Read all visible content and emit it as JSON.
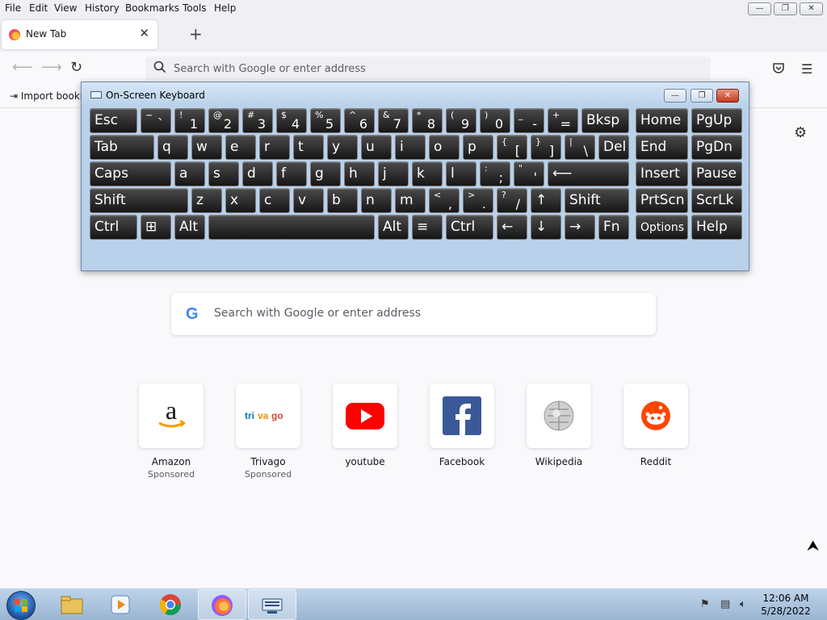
{
  "menubar": {
    "items": [
      "File",
      "Edit",
      "View",
      "History",
      "Bookmarks",
      "Tools",
      "Help"
    ]
  },
  "tabs": {
    "active_title": "New Tab",
    "close_glyph": "✕",
    "new_tab_glyph": "+"
  },
  "navbar": {
    "url_placeholder": "Search with Google or enter address"
  },
  "bookmarks": {
    "import_label": "Import bookmarks"
  },
  "osk": {
    "title": "On-Screen Keyboard",
    "rows": [
      [
        {
          "label": "Esc"
        },
        {
          "shift": "~",
          "main": "`"
        },
        {
          "shift": "!",
          "main": "1"
        },
        {
          "shift": "@",
          "main": "2"
        },
        {
          "shift": "#",
          "main": "3"
        },
        {
          "shift": "$",
          "main": "4"
        },
        {
          "shift": "%",
          "main": "5"
        },
        {
          "shift": "^",
          "main": "6"
        },
        {
          "shift": "&",
          "main": "7"
        },
        {
          "shift": "*",
          "main": "8"
        },
        {
          "shift": "(",
          "main": "9"
        },
        {
          "shift": ")",
          "main": "0"
        },
        {
          "shift": "_",
          "main": "-"
        },
        {
          "shift": "+",
          "main": "="
        },
        {
          "label": "Bksp"
        },
        {
          "label": "Home"
        },
        {
          "label": "PgUp"
        }
      ],
      [
        {
          "label": "Tab"
        },
        {
          "label": "q"
        },
        {
          "label": "w"
        },
        {
          "label": "e"
        },
        {
          "label": "r"
        },
        {
          "label": "t"
        },
        {
          "label": "y"
        },
        {
          "label": "u"
        },
        {
          "label": "i"
        },
        {
          "label": "o"
        },
        {
          "label": "p"
        },
        {
          "shift": "{",
          "main": "["
        },
        {
          "shift": "}",
          "main": "]"
        },
        {
          "shift": "|",
          "main": "\\"
        },
        {
          "label": "Del"
        },
        {
          "label": "End"
        },
        {
          "label": "PgDn"
        }
      ],
      [
        {
          "label": "Caps"
        },
        {
          "label": "a"
        },
        {
          "label": "s"
        },
        {
          "label": "d"
        },
        {
          "label": "f"
        },
        {
          "label": "g"
        },
        {
          "label": "h"
        },
        {
          "label": "j"
        },
        {
          "label": "k"
        },
        {
          "label": "l"
        },
        {
          "shift": ":",
          "main": ";"
        },
        {
          "shift": "\"",
          "main": "'"
        },
        {
          "label": "⟵"
        },
        {
          "label": "Insert"
        },
        {
          "label": "Pause"
        }
      ],
      [
        {
          "label": "Shift"
        },
        {
          "label": "z"
        },
        {
          "label": "x"
        },
        {
          "label": "c"
        },
        {
          "label": "v"
        },
        {
          "label": "b"
        },
        {
          "label": "n"
        },
        {
          "label": "m"
        },
        {
          "shift": "<",
          "main": ","
        },
        {
          "shift": ">",
          "main": "."
        },
        {
          "shift": "?",
          "main": "/"
        },
        {
          "label": "↑"
        },
        {
          "label": "Shift"
        },
        {
          "label": "PrtScn"
        },
        {
          "label": "ScrLk"
        }
      ],
      [
        {
          "label": "Ctrl"
        },
        {
          "label": "⊞"
        },
        {
          "label": "Alt"
        },
        {
          "label": ""
        },
        {
          "label": "Alt"
        },
        {
          "label": "≡"
        },
        {
          "label": "Ctrl"
        },
        {
          "label": "←"
        },
        {
          "label": "↓"
        },
        {
          "label": "→"
        },
        {
          "label": "Fn"
        },
        {
          "label": "Options"
        },
        {
          "label": "Help"
        }
      ]
    ]
  },
  "search": {
    "placeholder": "Search with Google or enter address",
    "logo": "G"
  },
  "shortcuts": [
    {
      "name": "Amazon",
      "sponsored": "Sponsored"
    },
    {
      "name": "Trivago",
      "sponsored": "Sponsored"
    },
    {
      "name": "youtube",
      "sponsored": ""
    },
    {
      "name": "Facebook",
      "sponsored": ""
    },
    {
      "name": "Wikipedia",
      "sponsored": ""
    },
    {
      "name": "Reddit",
      "sponsored": ""
    }
  ],
  "taskbar": {
    "time": "12:06 AM",
    "date": "5/28/2022"
  }
}
